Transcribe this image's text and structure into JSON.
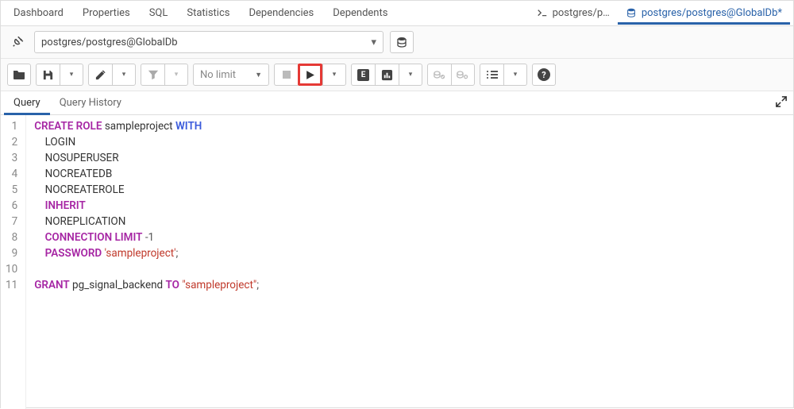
{
  "topTabs": {
    "dashboard": "Dashboard",
    "properties": "Properties",
    "sql": "SQL",
    "statistics": "Statistics",
    "dependencies": "Dependencies",
    "dependents": "Dependents"
  },
  "fileTabs": {
    "inactive": "postgres/p…",
    "active": "postgres/postgres@GlobalDb*"
  },
  "connection": {
    "value": "postgres/postgres@GlobalDb"
  },
  "toolbar": {
    "limit_label": "No limit"
  },
  "queryTabs": {
    "query": "Query",
    "history": "Query History"
  },
  "gutter": [
    "1",
    "2",
    "3",
    "4",
    "5",
    "6",
    "7",
    "8",
    "9",
    "10",
    "11"
  ],
  "sql": {
    "l1": {
      "create": "CREATE",
      "role": "ROLE",
      "name": " sampleproject ",
      "with": "WITH"
    },
    "l2": "LOGIN",
    "l3": "NOSUPERUSER",
    "l4": "NOCREATEDB",
    "l5": "NOCREATEROLE",
    "l6": "INHERIT",
    "l7": "NOREPLICATION",
    "l8": {
      "conn": "CONNECTION",
      "limit": "LIMIT",
      "val": " -1"
    },
    "l9": {
      "pwd": "PASSWORD",
      "str": " 'sampleproject'",
      "semi": ";"
    },
    "l11": {
      "grant": "GRANT",
      "name": " pg_signal_backend ",
      "to": "TO",
      "str": " \"sampleproject\"",
      "semi": ";"
    }
  }
}
